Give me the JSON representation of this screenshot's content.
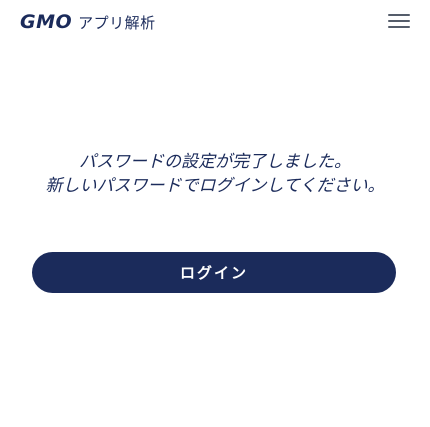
{
  "header": {
    "logo_mark": "GMO",
    "logo_sub": "アプリ解析"
  },
  "main": {
    "message_line1": "パスワードの設定が完了しました。",
    "message_line2": "新しいパスワードでログインしてください。",
    "login_label": "ログイン"
  },
  "colors": {
    "brand_navy": "#1b2b5b",
    "menu_gray": "#555d6b",
    "background": "#ffffff"
  },
  "icons": {
    "menu": "hamburger-menu-icon"
  }
}
